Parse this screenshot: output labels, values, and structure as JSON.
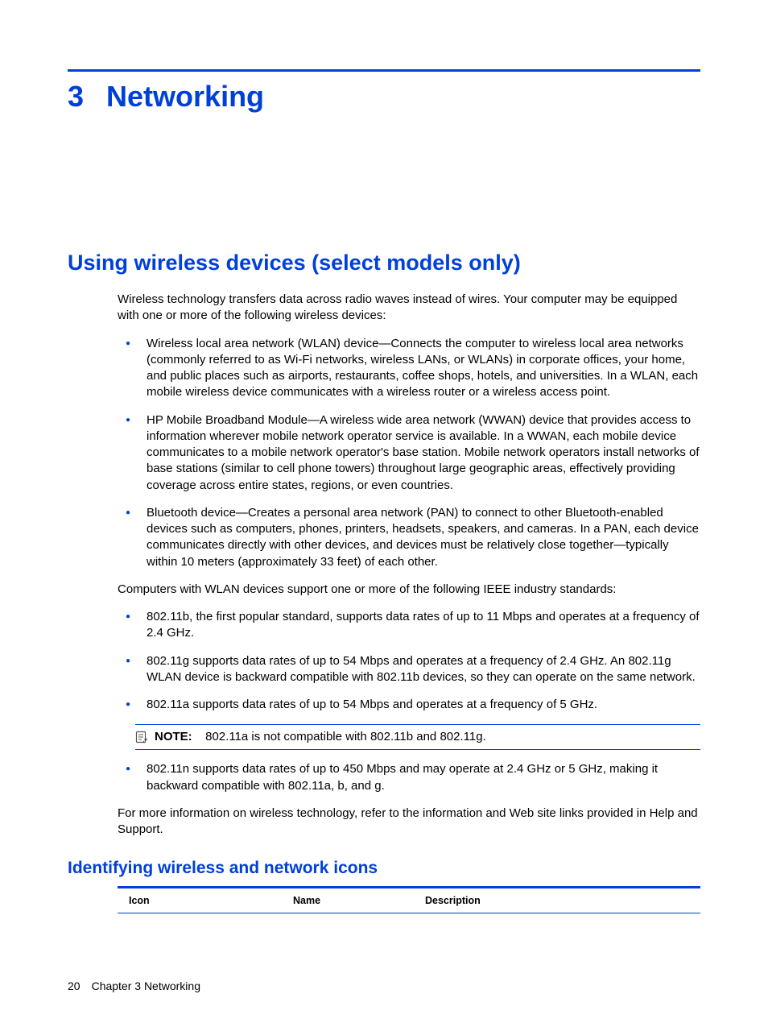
{
  "chapter": {
    "number": "3",
    "title": "Networking"
  },
  "section": {
    "title": "Using wireless devices (select models only)",
    "intro": "Wireless technology transfers data across radio waves instead of wires. Your computer may be equipped with one or more of the following wireless devices:",
    "devices": [
      "Wireless local area network (WLAN) device—Connects the computer to wireless local area networks (commonly referred to as Wi-Fi networks, wireless LANs, or WLANs) in corporate offices, your home, and public places such as airports, restaurants, coffee shops, hotels, and universities. In a WLAN, each mobile wireless device communicates with a wireless router or a wireless access point.",
      "HP Mobile Broadband Module—A wireless wide area network (WWAN) device that provides access to information wherever mobile network operator service is available. In a WWAN, each mobile device communicates to a mobile network operator's base station. Mobile network operators install networks of base stations (similar to cell phone towers) throughout large geographic areas, effectively providing coverage across entire states, regions, or even countries.",
      "Bluetooth device—Creates a personal area network (PAN) to connect to other Bluetooth-enabled devices such as computers, phones, printers, headsets, speakers, and cameras. In a PAN, each device communicates directly with other devices, and devices must be relatively close together—typically within 10 meters (approximately 33 feet) of each other."
    ],
    "standards_intro": "Computers with WLAN devices support one or more of the following IEEE industry standards:",
    "standards": [
      "802.11b, the first popular standard, supports data rates of up to 11 Mbps and operates at a frequency of 2.4 GHz.",
      "802.11g supports data rates of up to 54 Mbps and operates at a frequency of 2.4 GHz. An 802.11g WLAN device is backward compatible with 802.11b devices, so they can operate on the same network.",
      "802.11a supports data rates of up to 54 Mbps and operates at a frequency of 5 GHz."
    ],
    "note_label": "NOTE:",
    "note_text": "802.11a is not compatible with 802.11b and 802.11g.",
    "standards_after_note": [
      "802.11n supports data rates of up to 450 Mbps and may operate at 2.4 GHz or 5 GHz, making it backward compatible with 802.11a, b, and g."
    ],
    "outro": "For more information on wireless technology, refer to the information and Web site links provided in Help and Support."
  },
  "subsection": {
    "title": "Identifying wireless and network icons",
    "table_headers": {
      "icon": "Icon",
      "name": "Name",
      "description": "Description"
    }
  },
  "footer": {
    "page": "20",
    "chapter_label": "Chapter 3   Networking"
  }
}
